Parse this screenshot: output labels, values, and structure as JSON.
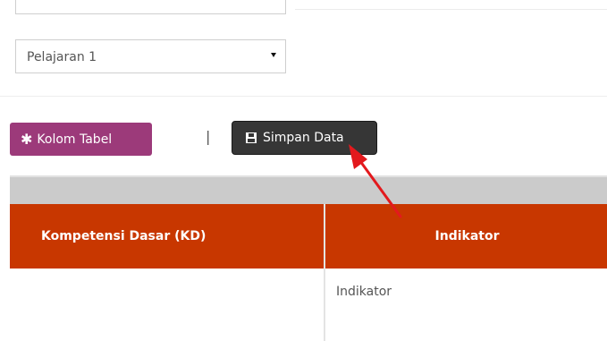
{
  "form": {
    "select": {
      "value": "Pelajaran 1"
    }
  },
  "toolbar": {
    "kolom_label": "Kolom Tabel",
    "separator": "|",
    "simpan_label": "Simpan Data"
  },
  "table": {
    "columns": [
      "Kompetensi Dasar (KD)",
      "Indikator"
    ],
    "rows": [
      {
        "kd": "",
        "indikator": "Indikator"
      }
    ]
  },
  "colors": {
    "kolom_button": "#9c3a7a",
    "simpan_button": "#363636",
    "table_header": "#c83700",
    "annotation_arrow": "#e3191d"
  },
  "icons": {
    "kolom_icon": "gear-icon",
    "simpan_icon": "floppy-disk-icon"
  }
}
